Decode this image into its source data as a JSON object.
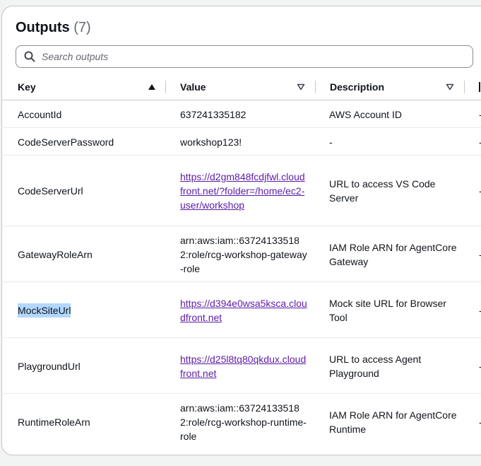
{
  "header": {
    "title": "Outputs",
    "count": "(7)"
  },
  "search": {
    "placeholder": "Search outputs",
    "icon": "search-icon"
  },
  "columns": [
    {
      "label": "Key",
      "sort": "ascending"
    },
    {
      "label": "Value",
      "sort": "none"
    },
    {
      "label": "Description",
      "sort": "none"
    }
  ],
  "rows": [
    {
      "key": "AccountId",
      "value": "637241335182",
      "value_is_link": false,
      "description": "AWS Account ID",
      "extra": "-"
    },
    {
      "key": "CodeServerPassword",
      "value": "workshop123!",
      "value_is_link": false,
      "description": "-",
      "extra": "-"
    },
    {
      "key": "CodeServerUrl",
      "value": "https://d2gm848fcdjfwl.cloudfront.net/?folder=/home/ec2-user/workshop",
      "value_is_link": true,
      "description": "URL to access VS Code Server",
      "extra": "-"
    },
    {
      "key": "GatewayRoleArn",
      "value": "arn:aws:iam::637241335182:role/rcg-workshop-gateway-role",
      "value_is_link": false,
      "description": "IAM Role ARN for AgentCore Gateway",
      "extra": "-"
    },
    {
      "key": "MockSiteUrl",
      "value": "https://d394e0wsa5ksca.cloudfront.net",
      "value_is_link": true,
      "description": "Mock site URL for Browser Tool",
      "extra": "-",
      "key_selected": true
    },
    {
      "key": "PlaygroundUrl",
      "value": "https://d25l8tq80qkdux.cloudfront.net",
      "value_is_link": true,
      "description": "URL to access Agent Playground",
      "extra": "-"
    },
    {
      "key": "RuntimeRoleArn",
      "value": "arn:aws:iam::637241335182:role/rcg-workshop-runtime-role",
      "value_is_link": false,
      "description": "IAM Role ARN for AgentCore Runtime",
      "extra": "-"
    }
  ],
  "colors": {
    "link": "#5c1ba7",
    "selection": "#b3d7ff",
    "border": "#c6c6cd"
  }
}
